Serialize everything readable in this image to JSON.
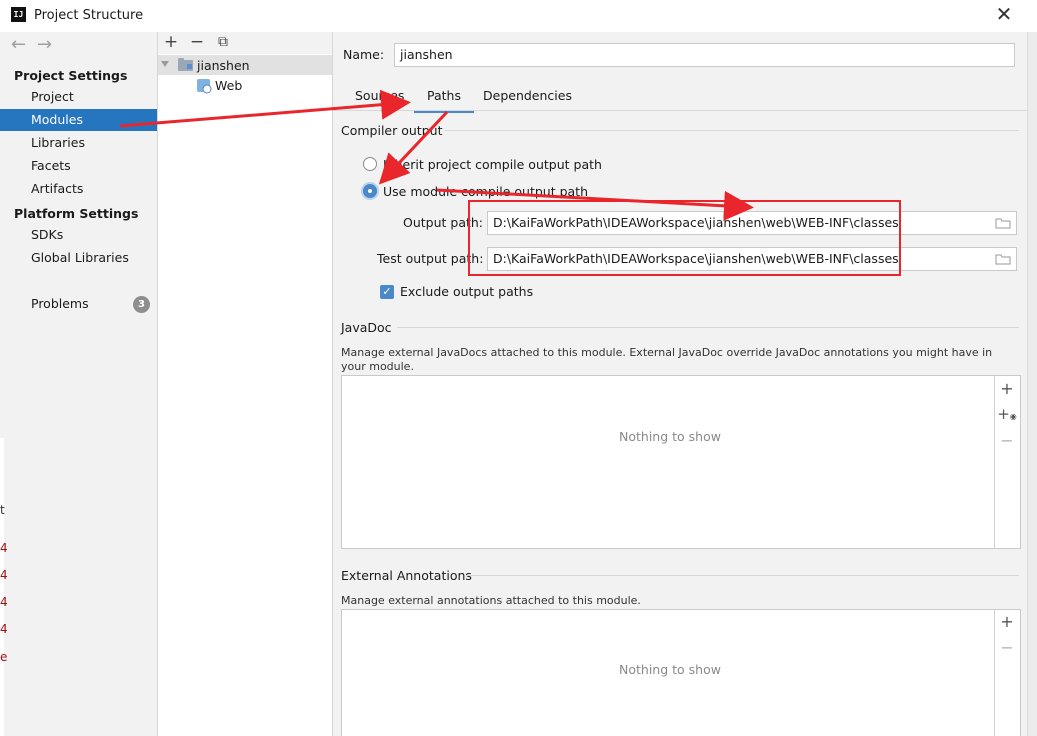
{
  "window": {
    "title": "Project Structure",
    "app_icon": "intellij-icon",
    "close_icon": "close-icon",
    "close_glyph": "✕"
  },
  "nav": {
    "back_glyph": "←",
    "forward_glyph": "→",
    "project_settings_title": "Project Settings",
    "project_settings_items": [
      "Project",
      "Modules",
      "Libraries",
      "Facets",
      "Artifacts"
    ],
    "platform_settings_title": "Platform Settings",
    "platform_settings_items": [
      "SDKs",
      "Global Libraries"
    ],
    "problems_label": "Problems",
    "problems_count": "3",
    "selected": "Modules"
  },
  "tree": {
    "toolbar": {
      "add": "+",
      "remove": "−",
      "copy": "⧉"
    },
    "root": "jianshen",
    "child": "Web"
  },
  "module": {
    "name_label": "Name:",
    "name_value": "jianshen",
    "tabs": [
      "Sources",
      "Paths",
      "Dependencies"
    ],
    "active_tab": "Paths",
    "compiler_output_title": "Compiler output",
    "radio_inherit": "Inherit project compile output path",
    "radio_module": "Use module compile output path",
    "output_path_label": "Output path:",
    "output_path_value": "D:\\KaiFaWorkPath\\IDEAWorkspace\\jianshen\\web\\WEB-INF\\classes",
    "test_output_path_label": "Test output path:",
    "test_output_path_value": "D:\\KaiFaWorkPath\\IDEAWorkspace\\jianshen\\web\\WEB-INF\\classes",
    "exclude_label": "Exclude output paths",
    "exclude_checked": true,
    "javadoc_title": "JavaDoc",
    "javadoc_desc": "Manage external JavaDocs attached to this module. External JavaDoc override JavaDoc annotations you might have in your module.",
    "javadoc_empty": "Nothing to show",
    "annotations_title": "External Annotations",
    "annotations_desc": "Manage external annotations attached to this module.",
    "annotations_empty": "Nothing to show"
  },
  "background": {
    "sliver_chars": [
      "t",
      "4",
      "4",
      "4",
      "4",
      "e"
    ]
  },
  "colors": {
    "selection": "#2675bf",
    "accent": "#4a88c7",
    "annotation_red": "#e8262c"
  }
}
